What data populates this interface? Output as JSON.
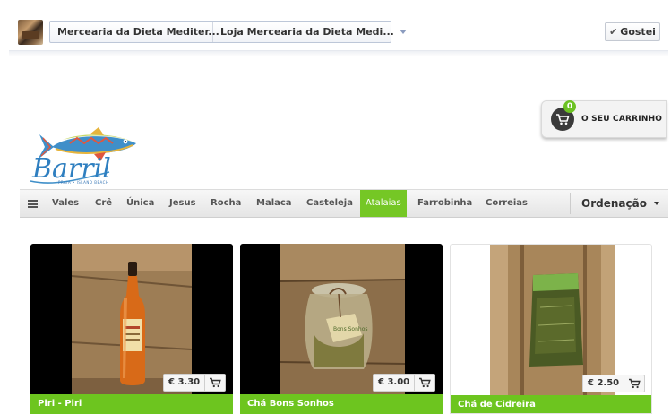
{
  "topbar": {
    "page_name": "Mercearia da Dieta Mediter...",
    "tab_name": "Loja Mercearia da Dieta Medi...",
    "like_label": "Gostei",
    "like_check": "✔"
  },
  "cart": {
    "badge_count": "0",
    "label": "O SEU CARRINHO"
  },
  "logo": {
    "wordmark": "Barril",
    "tagline": "PRAIA • ISLAND BEACH"
  },
  "nav": {
    "items": [
      "Vales",
      "Crê",
      "Única",
      "Jesus",
      "Rocha",
      "Malaca",
      "Casteleja",
      "Atalaias",
      "Farrobinha",
      "Correias"
    ],
    "active_item": "Atalaias",
    "sort_label": "Ordenação"
  },
  "products": [
    {
      "name": "Piri - Piri",
      "price": "€ 3.30"
    },
    {
      "name": "Chá Bons Sonhos",
      "price": "€ 3.00"
    },
    {
      "name": "Chá de Cidreira",
      "price": "€ 2.50"
    }
  ],
  "colors": {
    "accent_green": "#6dc51f",
    "fb_blue": "#3b5998"
  }
}
